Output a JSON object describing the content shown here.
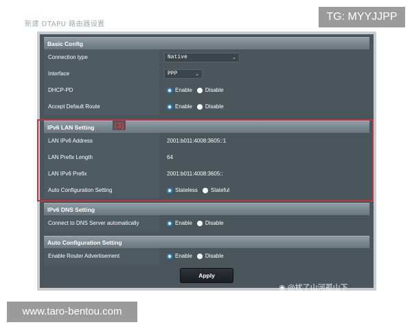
{
  "top_caption": "新建 DTAPU 路由器设置",
  "tg_badge": "TG: MYYJJPP",
  "basic_config": {
    "header": "Basic Config",
    "connection_type_label": "Connection type",
    "connection_type_value": "Native",
    "interface_label": "Interface",
    "interface_value": "PPP",
    "dhcp_pd_label": "DHCP-PD",
    "accept_default_route_label": "Accept Default Route"
  },
  "ipv6_lan": {
    "header": "IPv6 LAN Setting",
    "marker": "(3)",
    "lan_ipv6_address_label": "LAN IPv6 Address",
    "lan_ipv6_address_value": "2001:b011:4008:3605::1",
    "lan_prefix_length_label": "LAN Prefix Length",
    "lan_prefix_length_value": "64",
    "lan_ipv6_prefix_label": "LAN IPv6 Prefix",
    "lan_ipv6_prefix_value": "2001:b011:4008:3605::",
    "auto_config_label": "Auto Configuration Setting",
    "stateless_label": "Stateless",
    "stateful_label": "Stateful"
  },
  "ipv6_dns": {
    "header": "IPv6 DNS Setting",
    "connect_dns_label": "Connect to DNS Server automatically"
  },
  "auto_config": {
    "header": "Auto Configuration Setting",
    "router_adv_label": "Enable Router Advertisement"
  },
  "radio": {
    "enable_label": "Enable",
    "disable_label": "Disable"
  },
  "apply_label": "Apply",
  "watermark": "@扰了山河孤山下",
  "site_badge": "www.taro-bentou.com",
  "colors": {
    "accent": "#2a8cd8",
    "highlight": "#c0343b",
    "marker": "#e23b3b",
    "panel": "#4b555c"
  }
}
